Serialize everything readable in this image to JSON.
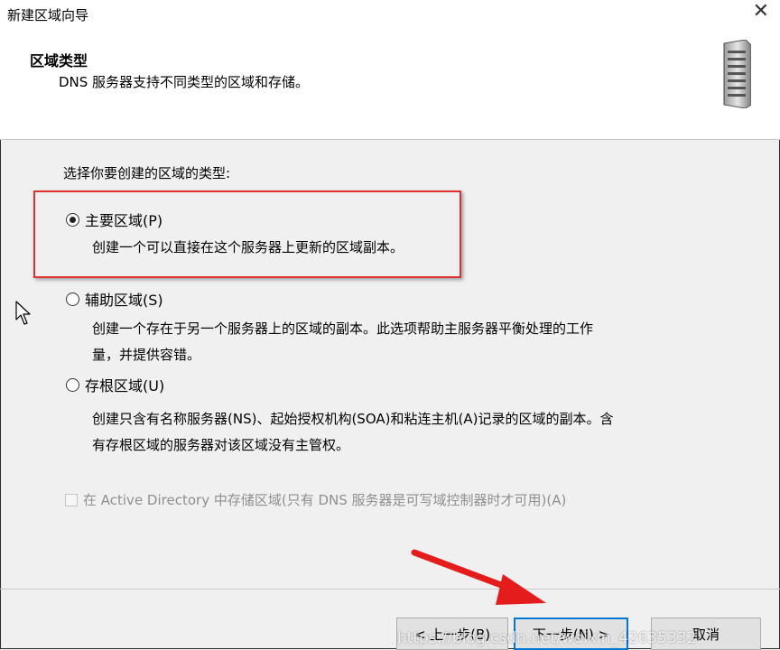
{
  "window": {
    "title": "新建区域向导"
  },
  "header": {
    "section_title": "区域类型",
    "section_desc": "DNS 服务器支持不同类型的区域和存储。"
  },
  "main": {
    "prompt": "选择你要创建的区域的类型:",
    "options": [
      {
        "label": "主要区域(P)",
        "checked": true,
        "desc_lines": [
          "创建一个可以直接在这个服务器上更新的区域副本。"
        ]
      },
      {
        "label": "辅助区域(S)",
        "checked": false,
        "desc_lines": [
          "创建一个存在于另一个服务器上的区域的副本。此选项帮助主服务器平衡处理的工作",
          "量，并提供容错。"
        ]
      },
      {
        "label": "存根区域(U)",
        "checked": false,
        "desc_lines": [
          "创建只含有名称服务器(NS)、起始授权机构(SOA)和粘连主机(A)记录的区域的副本。含",
          "有存根区域的服务器对该区域没有主管权。"
        ]
      }
    ],
    "ad_checkbox": {
      "label": "在 Active Directory 中存储区域(只有 DNS 服务器是可写域控制器时才可用)(A)",
      "checked": false,
      "disabled": true
    }
  },
  "footer": {
    "back_label": "< 上一步(B)",
    "next_label": "下一步(N) >",
    "cancel_label": "取消"
  },
  "watermark": "https://blog.csdn.net/weixin_42635332",
  "colors": {
    "highlight": "#e03030",
    "accent": "#0078d7",
    "arrow": "#e51c1c"
  }
}
